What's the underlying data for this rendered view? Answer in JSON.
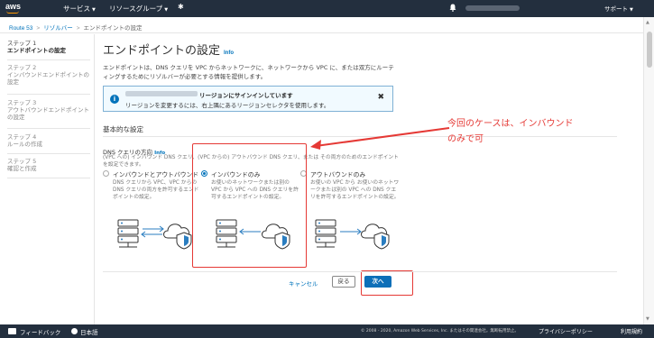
{
  "topnav": {
    "logo": "aws",
    "services_label": "サービス",
    "resource_groups_label": "リソースグループ",
    "support_label": "サポート"
  },
  "breadcrumb": [
    "Route 53",
    "リゾルバー",
    "エンドポイントの設定"
  ],
  "steps": [
    {
      "num": "ステップ 1",
      "name": "エンドポイントの設定",
      "active": true
    },
    {
      "num": "ステップ 2",
      "name": "インバウンドエンドポイントの設定",
      "active": false
    },
    {
      "num": "ステップ 3",
      "name": "アウトバウンドエンドポイントの設定",
      "active": false
    },
    {
      "num": "ステップ 4",
      "name": "ルールの作成",
      "active": false
    },
    {
      "num": "ステップ 5",
      "name": "確認と作成",
      "active": false
    }
  ],
  "main": {
    "title": "エンドポイントの設定",
    "info_link": "Info",
    "description": "エンドポイントは、DNS クエリを VPC からネットワークに、ネットワークから VPC に、または双方にルーティングするためにリゾルバーが必要とする情報を提供します。"
  },
  "alert": {
    "title": "リージョンにサインインしています",
    "text": "リージョンを変更するには、右上隅にあるリージョンセレクタを使用します。"
  },
  "section": {
    "title": "基本的な設定",
    "field_label": "DNS クエリの方向",
    "field_info": "Info",
    "field_desc": "(VPC への) インバウンド DNS クエリ、(VPC からの) アウトバウンド DNS クエリ、または その両方のためのエンドポイントを設定できます。"
  },
  "options": [
    {
      "title": "インバウンドとアウトバウンド",
      "desc": "DNS クエリから VPC、VPC からの DNS クエリの両方を許可するエンドポイントの設定。",
      "checked": false
    },
    {
      "title": "インバウンドのみ",
      "desc": "お使いのネットワークまたは別の VPC から VPC への DNS クエリを許可するエンドポイントの設定。",
      "checked": true
    },
    {
      "title": "アウトバウンドのみ",
      "desc": "お使いの VPC から お使いのネットワークまたは別の VPC への DNS クエリを許可するエンドポイントの設定。",
      "checked": false
    }
  ],
  "annotation": {
    "line1": "今回のケースは、インバウンド",
    "line2": "のみで可",
    "color": "#e53935"
  },
  "actions": {
    "cancel": "キャンセル",
    "back": "戻る",
    "next": "次へ"
  },
  "bottombar": {
    "feedback": "フィードバック",
    "language": "日本語",
    "copyright": "© 2008 - 2020, Amazon Web Services, Inc. またはその関連会社。無断転用禁止。",
    "privacy": "プライバシーポリシー",
    "terms": "利用規約"
  },
  "colors": {
    "nav_bg": "#232f3e",
    "accent": "#ff9900",
    "link": "#0073bb",
    "primary_button": "#0d6fb8"
  }
}
